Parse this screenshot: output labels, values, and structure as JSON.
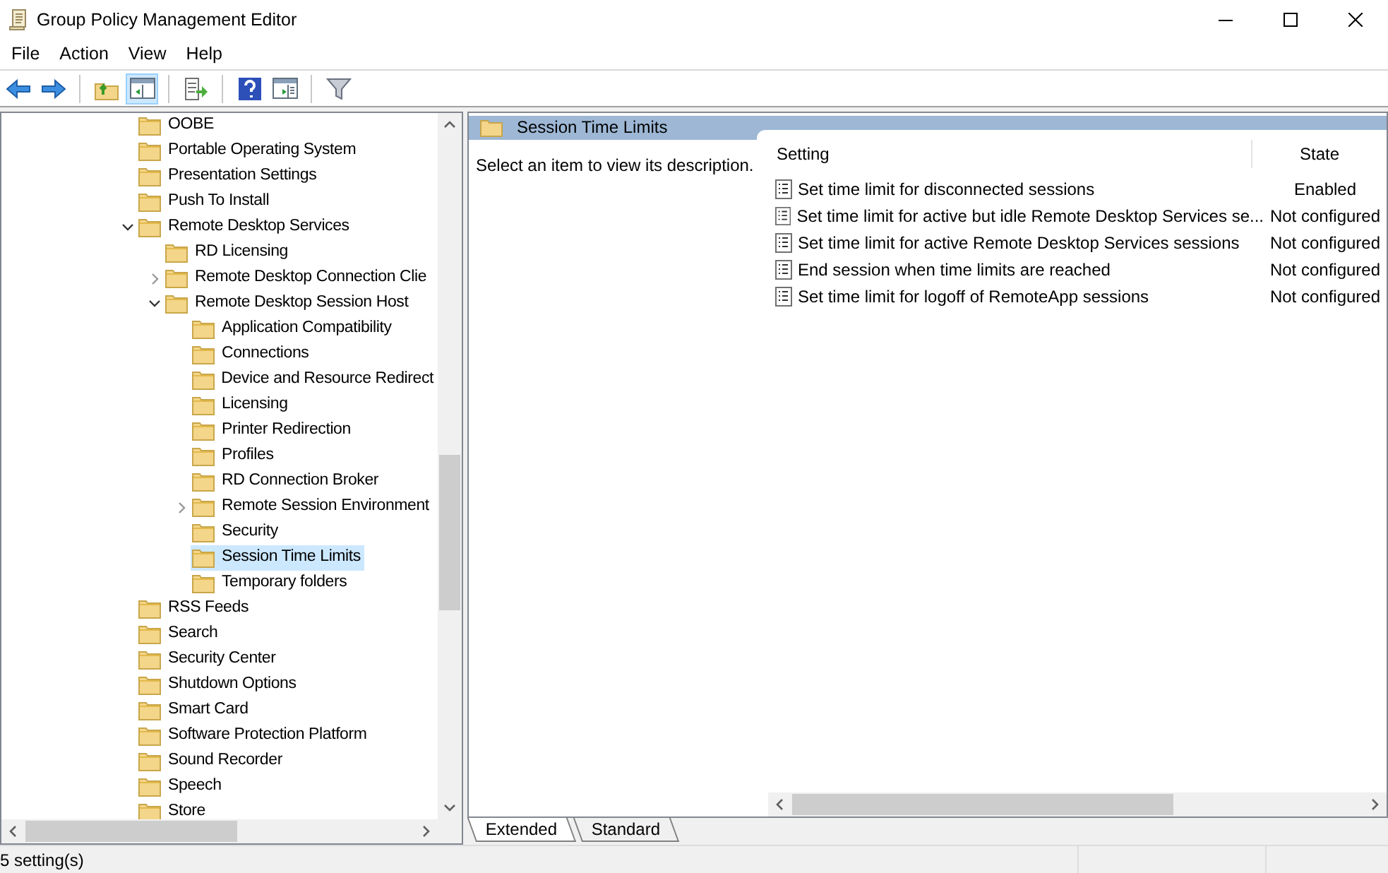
{
  "window": {
    "title": "Group Policy Management Editor"
  },
  "menu": [
    "File",
    "Action",
    "View",
    "Help"
  ],
  "toolbar": [
    {
      "kind": "back"
    },
    {
      "kind": "forward"
    },
    {
      "kind": "sep"
    },
    {
      "kind": "up"
    },
    {
      "kind": "pane",
      "selected": true
    },
    {
      "kind": "sep"
    },
    {
      "kind": "export"
    },
    {
      "kind": "sep"
    },
    {
      "kind": "help"
    },
    {
      "kind": "view"
    },
    {
      "kind": "sep"
    },
    {
      "kind": "filter"
    }
  ],
  "tree": [
    {
      "label": "OOBE",
      "selected": false
    },
    {
      "label": "Portable Operating System",
      "selected": false
    },
    {
      "label": "Presentation Settings",
      "selected": false
    },
    {
      "label": "Push To Install",
      "selected": false
    },
    {
      "label": "Remote Desktop Services",
      "selected": false,
      "expanded": true,
      "children": [
        {
          "label": "RD Licensing",
          "selected": false
        },
        {
          "label": "Remote Desktop Connection Clie",
          "selected": false,
          "expanded": false
        },
        {
          "label": "Remote Desktop Session Host",
          "selected": false,
          "expanded": true,
          "children": [
            {
              "label": "Application Compatibility",
              "selected": false
            },
            {
              "label": "Connections",
              "selected": false
            },
            {
              "label": "Device and Resource Redirect",
              "selected": false
            },
            {
              "label": "Licensing",
              "selected": false
            },
            {
              "label": "Printer Redirection",
              "selected": false
            },
            {
              "label": "Profiles",
              "selected": false
            },
            {
              "label": "RD Connection Broker",
              "selected": false
            },
            {
              "label": "Remote Session Environment",
              "selected": false,
              "expanded": false
            },
            {
              "label": "Security",
              "selected": false
            },
            {
              "label": "Session Time Limits",
              "selected": true
            },
            {
              "label": "Temporary folders",
              "selected": false
            }
          ]
        }
      ]
    },
    {
      "label": "RSS Feeds",
      "selected": false
    },
    {
      "label": "Search",
      "selected": false
    },
    {
      "label": "Security Center",
      "selected": false
    },
    {
      "label": "Shutdown Options",
      "selected": false
    },
    {
      "label": "Smart Card",
      "selected": false
    },
    {
      "label": "Software Protection Platform",
      "selected": false
    },
    {
      "label": "Sound Recorder",
      "selected": false
    },
    {
      "label": "Speech",
      "selected": false
    },
    {
      "label": "Store",
      "selected": false
    }
  ],
  "details": {
    "title": "Session Time Limits",
    "description": "Select an item to view its description.",
    "columns": [
      "Setting",
      "State"
    ],
    "rows": [
      {
        "setting": "Set time limit for disconnected sessions",
        "state": "Enabled"
      },
      {
        "setting": "Set time limit for active but idle Remote Desktop Services se...",
        "state": "Not configured"
      },
      {
        "setting": "Set time limit for active Remote Desktop Services sessions",
        "state": "Not configured"
      },
      {
        "setting": "End session when time limits are reached",
        "state": "Not configured"
      },
      {
        "setting": "Set time limit for logoff of RemoteApp sessions",
        "state": "Not configured"
      }
    ]
  },
  "view_tabs": [
    {
      "label": "Extended",
      "selected": true
    },
    {
      "label": "Standard",
      "selected": false
    }
  ],
  "status_bar": "5 setting(s)"
}
